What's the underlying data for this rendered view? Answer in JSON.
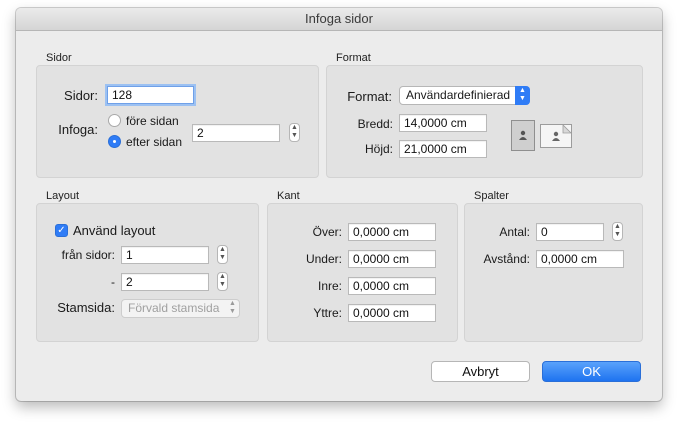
{
  "window": {
    "title": "Infoga sidor"
  },
  "sidor": {
    "section_title": "Sidor",
    "sidor_label": "Sidor:",
    "sidor_value": "128",
    "infoga_label": "Infoga:",
    "before_label": "före sidan",
    "after_label": "efter sidan",
    "selected": "efter sidan",
    "page_value": "2"
  },
  "format": {
    "section_title": "Format",
    "format_label": "Format:",
    "format_value": "Användardefinierad",
    "width_label": "Bredd:",
    "width_value": "14,0000 cm",
    "height_label": "Höjd:",
    "height_value": "21,0000 cm",
    "orientation_selected": "portrait"
  },
  "layout": {
    "section_title": "Layout",
    "use_layout_label": "Använd layout",
    "use_layout_checked": true,
    "from_label": "från sidor:",
    "from_value": "1",
    "dash_label": "-",
    "to_value": "2",
    "master_label": "Stamsida:",
    "master_value": "Förvald stamsida"
  },
  "kant": {
    "section_title": "Kant",
    "top_label": "Över:",
    "top_value": "0,0000 cm",
    "bottom_label": "Under:",
    "bottom_value": "0,0000 cm",
    "inner_label": "Inre:",
    "inner_value": "0,0000 cm",
    "outer_label": "Yttre:",
    "outer_value": "0,0000 cm"
  },
  "spalter": {
    "section_title": "Spalter",
    "count_label": "Antal:",
    "count_value": "0",
    "gap_label": "Avstånd:",
    "gap_value": "0,0000 cm"
  },
  "buttons": {
    "cancel_label": "Avbryt",
    "ok_label": "OK"
  },
  "colors": {
    "accent": "#2f7cf6",
    "panel": "#e2e2e2",
    "window": "#ececec"
  }
}
